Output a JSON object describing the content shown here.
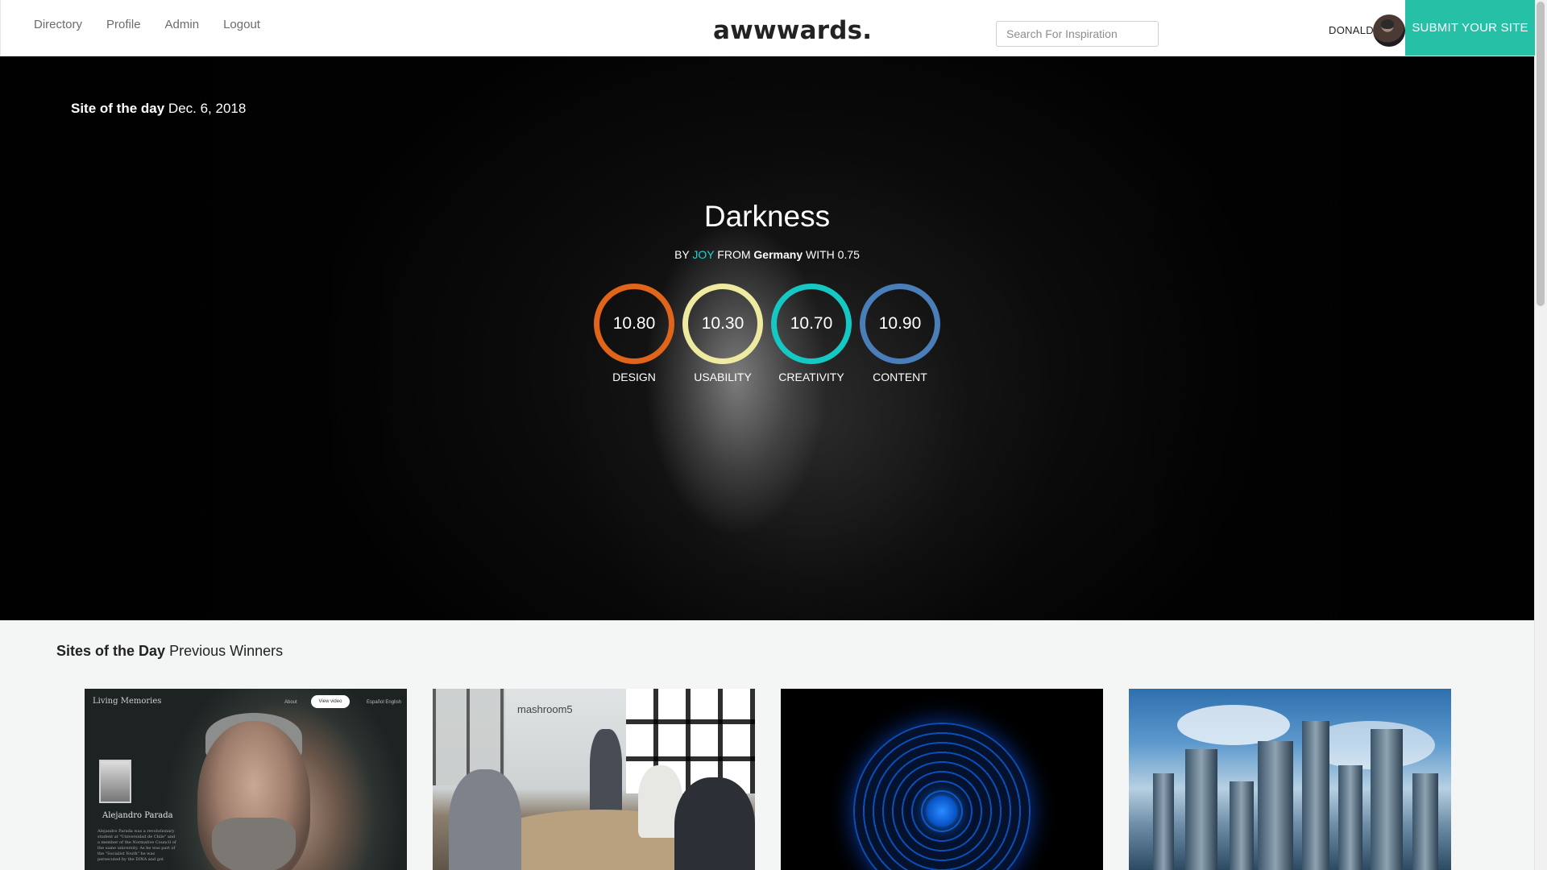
{
  "nav": {
    "links": [
      "Directory",
      "Profile",
      "Admin",
      "Logout"
    ],
    "logo": "awwwards.",
    "search_placeholder": "Search For Inspiration",
    "user_name": "DONALD",
    "submit_label": "SUBMIT YOUR SITE",
    "accent_color": "#25c0a6"
  },
  "hero": {
    "sotd_label": "Site of the day",
    "date": "Dec. 6, 2018",
    "title": "Darkness",
    "by_prefix": "BY",
    "author": "JOY",
    "from_word": "FROM",
    "country": "Germany",
    "with_text": "WITH 0.75",
    "scores": [
      {
        "label": "DESIGN",
        "value": "10.80",
        "color": "#e0641a"
      },
      {
        "label": "USABILITY",
        "value": "10.30",
        "color": "#eeeaa0"
      },
      {
        "label": "CREATIVITY",
        "value": "10.70",
        "color": "#16c8c3"
      },
      {
        "label": "CONTENT",
        "value": "10.90",
        "color": "#4a7eb8"
      }
    ]
  },
  "winners": {
    "title_bold": "Sites of the Day",
    "title_rest": "Previous Winners",
    "card1": {
      "site_title": "Living Memories",
      "button": "View video",
      "nav_left": "About",
      "nav_right": "Español   English",
      "person_name": "Alejandro Parada",
      "bio": "Alejandro Parada was a revolutionary student at \"Universidad de Chile\" and a member of the Normative Council of the same university. As he was part of the \"Socialist Youth\" he was persecuted by the DINA and got"
    },
    "card2": {
      "whiteboard_text": "mashroom5"
    }
  }
}
